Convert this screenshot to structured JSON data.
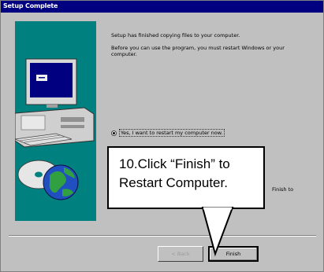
{
  "window": {
    "title": "Setup Complete"
  },
  "message": {
    "line1": "Setup has finished copying files to your computer.",
    "line2": "Before you can use the program, you must restart Windows or your computer."
  },
  "radio": {
    "label": "Yes, I want to restart my computer now.",
    "selected": true
  },
  "trailing_text": "Finish to",
  "buttons": {
    "back": "< Back",
    "finish": "Finish"
  },
  "callout": {
    "line1": "10.Click “Finish” to",
    "line2": "Restart Computer."
  },
  "colors": {
    "titlebar": "#000080",
    "dialog": "#c0c0c0",
    "art_background": "#00807f"
  },
  "icons": [
    "monitor-icon",
    "computer-icon",
    "globe-icon",
    "disk-icon"
  ]
}
